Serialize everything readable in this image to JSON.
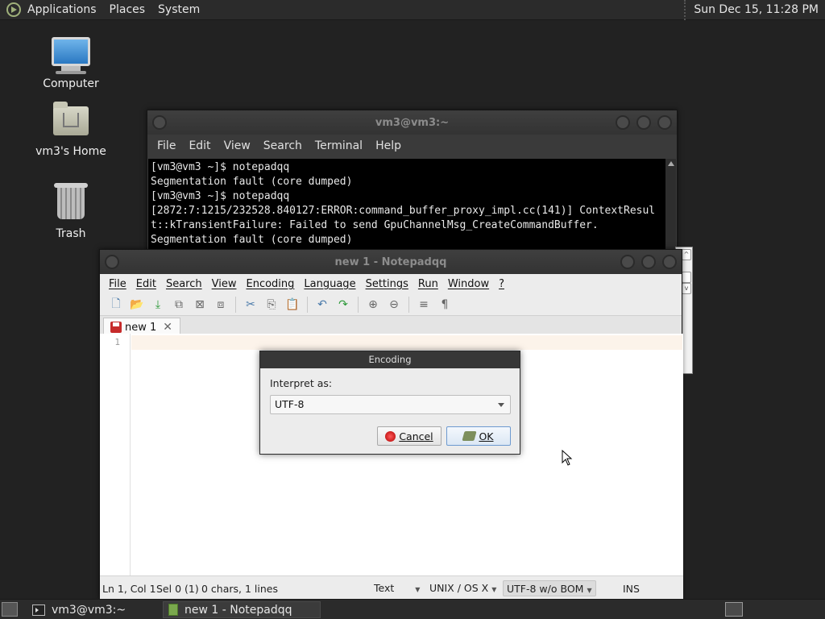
{
  "top_panel": {
    "menus": [
      "Applications",
      "Places",
      "System"
    ],
    "clock": "Sun Dec 15, 11:28 PM"
  },
  "desktop": {
    "icons": [
      {
        "label": "Computer",
        "icon": "computer-icon"
      },
      {
        "label": "vm3's Home",
        "icon": "home-folder-icon"
      },
      {
        "label": "Trash",
        "icon": "trash-icon"
      }
    ]
  },
  "terminal": {
    "title": "vm3@vm3:~",
    "menu": [
      "File",
      "Edit",
      "View",
      "Search",
      "Terminal",
      "Help"
    ],
    "lines": [
      "[vm3@vm3 ~]$ notepadqq",
      "Segmentation fault (core dumped)",
      "[vm3@vm3 ~]$ notepadqq",
      "[2872:7:1215/232528.840127:ERROR:command_buffer_proxy_impl.cc(141)] ContextResul",
      "t::kTransientFailure: Failed to send GpuChannelMsg_CreateCommandBuffer.",
      "Segmentation fault (core dumped)"
    ]
  },
  "notepad": {
    "title": "new 1 - Notepadqq",
    "menu": [
      "File",
      "Edit",
      "Search",
      "View",
      "Encoding",
      "Language",
      "Settings",
      "Run",
      "Window",
      "?"
    ],
    "tab": {
      "label": "new 1",
      "close": "✕"
    },
    "line_number": "1",
    "status": {
      "position": "Ln 1, Col 1",
      "selection": "Sel 0 (1)",
      "counts": "0 chars, 1 lines",
      "language": "Text",
      "line_ending": "UNIX / OS X",
      "encoding": "UTF-8 w/o BOM",
      "mode": "INS"
    }
  },
  "dialog": {
    "title": "Encoding",
    "label": "Interpret as:",
    "selected": "UTF-8",
    "cancel": "Cancel",
    "ok": "OK"
  },
  "taskbar": {
    "tasks": [
      {
        "label": "vm3@vm3:~",
        "icon": "terminal-icon"
      },
      {
        "label": "new 1 - Notepadqq",
        "icon": "notepadqq-icon"
      }
    ]
  }
}
